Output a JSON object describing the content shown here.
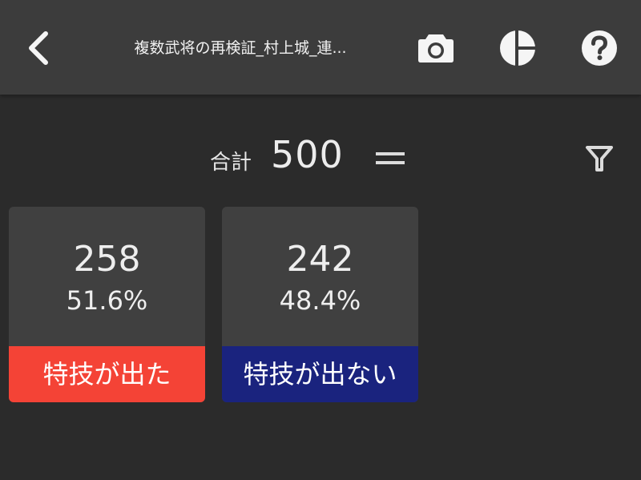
{
  "header": {
    "title": "複数武将の再検証_村上城_連...",
    "icons": {
      "back": "chevron-left-icon",
      "camera": "camera-icon",
      "chart": "pie-chart-icon",
      "help": "help-icon"
    }
  },
  "summary": {
    "total_label": "合計",
    "total_value": "500",
    "icons": {
      "equals": "equals-icon",
      "filter": "filter-icon"
    }
  },
  "cards": [
    {
      "count": "258",
      "percent": "51.6%",
      "label": "特技が出た",
      "color": "#f44336"
    },
    {
      "count": "242",
      "percent": "48.4%",
      "label": "特技が出ない",
      "color": "#1a237e"
    }
  ],
  "colors": {
    "background": "#2b2b2b",
    "header": "#3c3c3c",
    "card": "#404040",
    "icon": "#f5f5f5"
  }
}
